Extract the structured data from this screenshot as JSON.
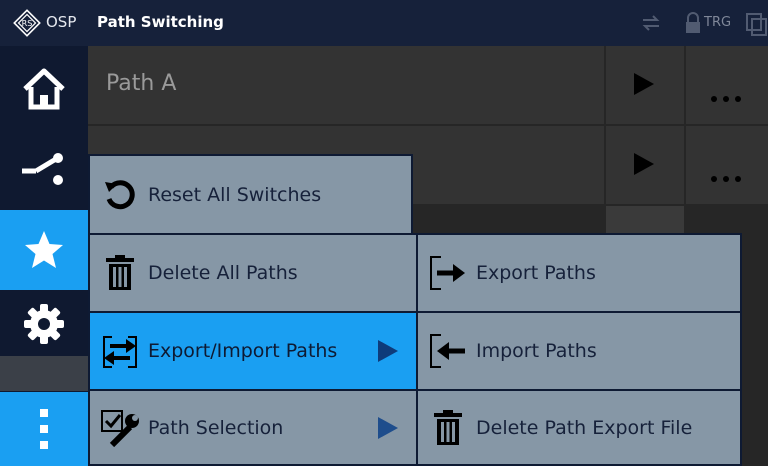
{
  "titlebar": {
    "app_name": "OSP",
    "page_title": "Path Switching",
    "trg_label": "TRG"
  },
  "nav": {
    "items": [
      {
        "icon": "home-icon",
        "active": false
      },
      {
        "icon": "path-switch-icon",
        "active": false
      },
      {
        "icon": "star-icon",
        "active": true
      },
      {
        "icon": "gear-icon",
        "active": false
      },
      {
        "icon": "more-vertical-icon",
        "active": true
      }
    ]
  },
  "paths": [
    {
      "name": "Path A"
    },
    {
      "name": ""
    }
  ],
  "menu": {
    "primary": [
      {
        "label": "Reset All Switches",
        "icon": "reset-icon",
        "has_submenu": false,
        "active": false
      },
      {
        "label": "Delete All Paths",
        "icon": "trash-icon",
        "has_submenu": false,
        "active": false
      },
      {
        "label": "Export/Import Paths",
        "icon": "export-import-icon",
        "has_submenu": true,
        "active": true
      },
      {
        "label": "Path Selection",
        "icon": "path-selection-icon",
        "has_submenu": true,
        "active": false
      }
    ],
    "submenu": [
      {
        "label": "Export Paths",
        "icon": "export-icon"
      },
      {
        "label": "Import Paths",
        "icon": "import-icon"
      },
      {
        "label": "Delete Path Export File",
        "icon": "trash-icon"
      }
    ]
  },
  "colors": {
    "accent": "#1a9ff2",
    "menu_bg": "#8697a6",
    "titlebar_bg": "#16213a"
  }
}
